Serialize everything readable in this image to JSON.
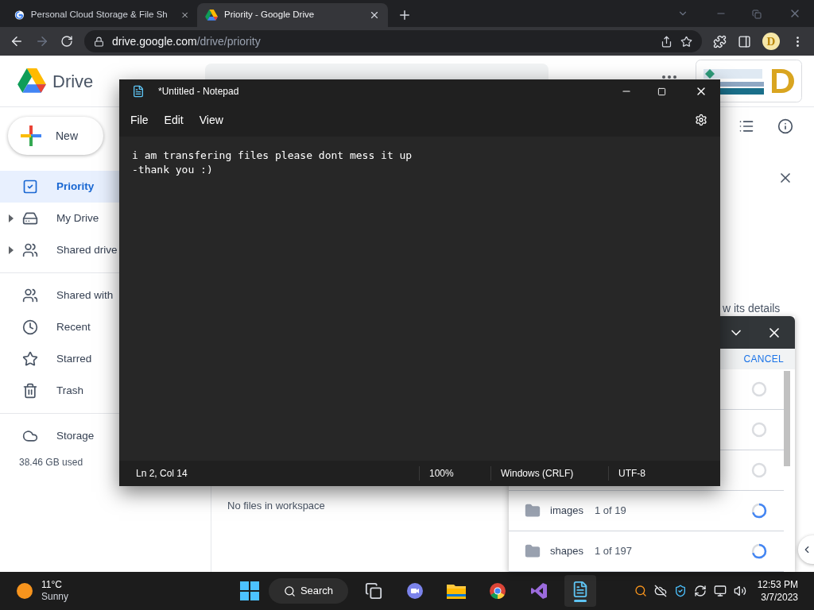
{
  "browser": {
    "tabs": [
      {
        "kind": "google",
        "title": "Personal Cloud Storage & File Sh",
        "selected": false
      },
      {
        "kind": "drive",
        "title": "Priority - Google Drive",
        "selected": true
      }
    ],
    "url": {
      "host": "drive.google.com",
      "path": "/drive/priority"
    },
    "profile": "D"
  },
  "drive": {
    "product": "Drive",
    "new_button": "New",
    "sidebar_groups": [
      [
        {
          "kind": "priority",
          "label": "Priority",
          "selected": true,
          "expandable": false
        },
        {
          "kind": "mydrive",
          "label": "My Drive",
          "selected": false,
          "expandable": true
        },
        {
          "kind": "shared",
          "label": "Shared drive",
          "selected": false,
          "expandable": true
        }
      ],
      [
        {
          "kind": "people",
          "label": "Shared with",
          "selected": false,
          "expandable": false
        },
        {
          "kind": "recent",
          "label": "Recent",
          "selected": false,
          "expandable": false
        },
        {
          "kind": "star",
          "label": "Starred",
          "selected": false,
          "expandable": false
        },
        {
          "kind": "trash",
          "label": "Trash",
          "selected": false,
          "expandable": false
        }
      ],
      [
        {
          "kind": "cloud",
          "label": "Storage",
          "selected": false,
          "expandable": false
        }
      ]
    ],
    "storage_used": "38.46 GB used",
    "empty_message": "No files in workspace",
    "details_hint": "w its details",
    "uploads": {
      "cancel": "CANCEL",
      "rows": [
        {
          "uploading": false
        },
        {
          "uploading": false
        },
        {
          "uploading": false
        },
        {
          "name": "images",
          "count": "1 of 19",
          "uploading": true
        },
        {
          "name": "shapes",
          "count": "1 of 197",
          "uploading": true
        }
      ]
    }
  },
  "notepad": {
    "title": "*Untitled - Notepad",
    "menu": [
      "File",
      "Edit",
      "View"
    ],
    "lines": [
      "i am transfering files please dont mess it up",
      "-thank you :)"
    ],
    "status": [
      "Ln 2, Col 14",
      "100%",
      "Windows (CRLF)",
      "UTF-8"
    ]
  },
  "taskbar": {
    "temperature": "11°C",
    "weather": "Sunny",
    "search": "Search",
    "apps": [
      {
        "kind": "taskview",
        "active": false
      },
      {
        "kind": "chat",
        "active": false
      },
      {
        "kind": "explorer",
        "active": false
      },
      {
        "kind": "chrome",
        "active": false
      },
      {
        "kind": "vs",
        "active": false
      },
      {
        "kind": "notepad",
        "active": true
      }
    ],
    "time": "12:53 PM",
    "date": "3/7/2023"
  }
}
